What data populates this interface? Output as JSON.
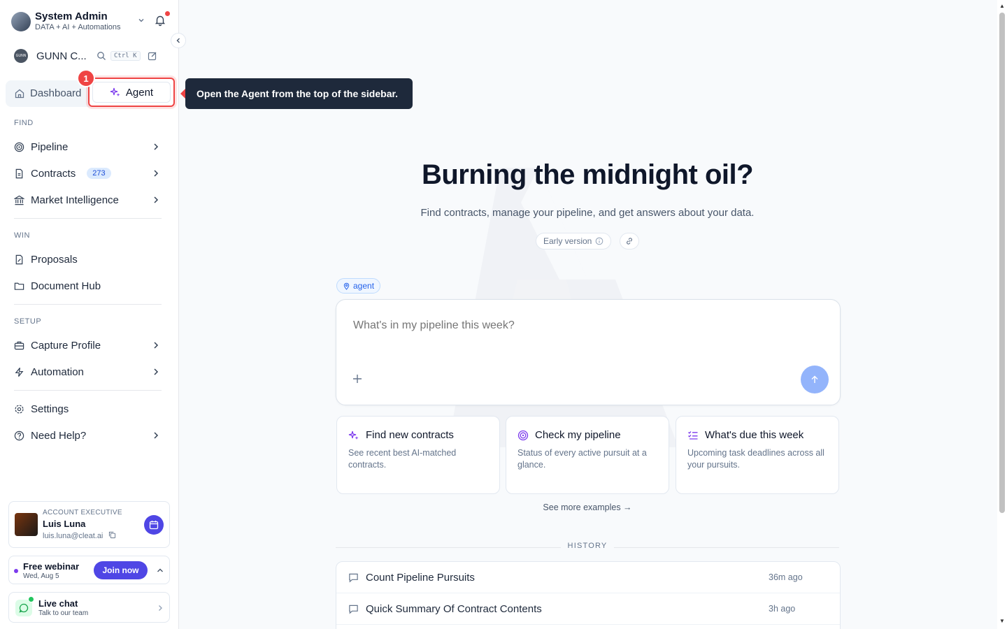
{
  "user": {
    "name": "System Admin",
    "subtitle": "DATA + AI + Automations"
  },
  "org": {
    "name": "GUNN C...",
    "avatar_text": "GUNN",
    "shortcut": "Ctrl K"
  },
  "toggle": {
    "dashboard": "Dashboard",
    "agent": "Agent",
    "step_badge": "1"
  },
  "tooltip": "Open the Agent from the top of the sidebar.",
  "sections": {
    "find": "FIND",
    "win": "WIN",
    "setup": "SETUP"
  },
  "nav": {
    "pipeline": "Pipeline",
    "contracts": "Contracts",
    "contracts_count": "273",
    "market": "Market Intelligence",
    "proposals": "Proposals",
    "document_hub": "Document Hub",
    "capture_profile": "Capture Profile",
    "automation": "Automation",
    "settings": "Settings",
    "help": "Need Help?"
  },
  "account_exec": {
    "role": "ACCOUNT EXECUTIVE",
    "name": "Luis Luna",
    "email": "luis.luna@cleat.ai"
  },
  "webinar": {
    "title": "Free webinar",
    "date": "Wed, Aug 5",
    "cta": "Join now"
  },
  "livechat": {
    "title": "Live chat",
    "subtitle": "Talk to our team"
  },
  "main": {
    "headline": "Burning the midnight oil?",
    "subheadline": "Find contracts, manage your pipeline, and get answers about your data.",
    "early": "Early version",
    "context_chip": "agent",
    "composer_placeholder": "What's in my pipeline this week?",
    "cards": [
      {
        "title": "Find new contracts",
        "desc": "See recent best AI-matched contracts."
      },
      {
        "title": "Check my pipeline",
        "desc": "Status of every active pursuit at a glance."
      },
      {
        "title": "What's due this week",
        "desc": "Upcoming task deadlines across all your pursuits."
      }
    ],
    "see_more": "See more examples →",
    "history_label": "HISTORY",
    "history": [
      {
        "title": "Count Pipeline Pursuits",
        "when": "36m ago"
      },
      {
        "title": "Quick Summary Of Contract Contents",
        "when": "3h ago"
      },
      {
        "title": "",
        "when": ""
      }
    ]
  },
  "colors": {
    "accent": "#4f46e5",
    "alert": "#ef4444",
    "agent_purple": "#7c3aed"
  }
}
